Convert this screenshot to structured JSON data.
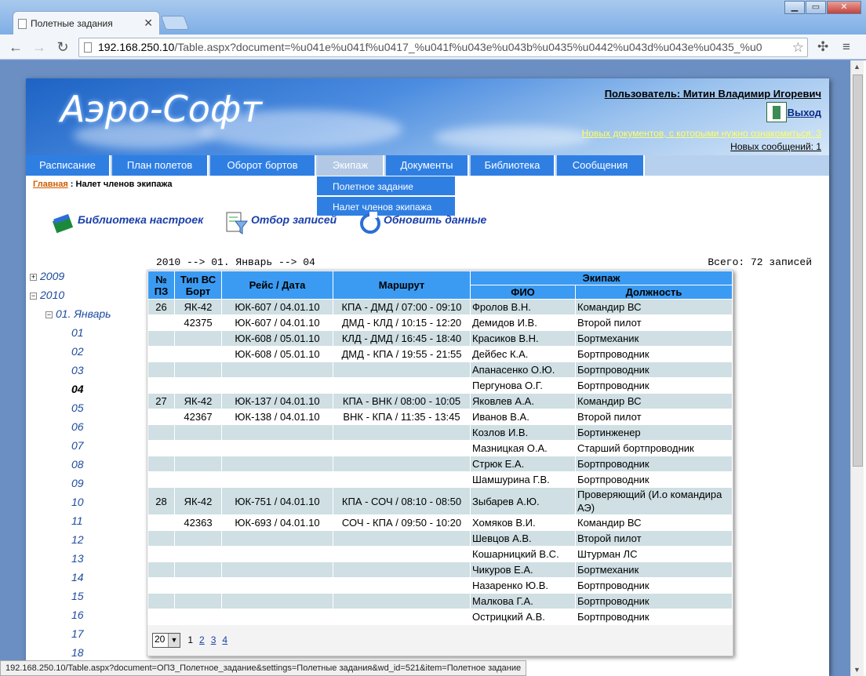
{
  "browser": {
    "tab_title": "Полетные задания",
    "url_host": "192.168.250.10",
    "url_path": "/Table.aspx?document=%u041e%u041f%u0417_%u041f%u043e%u043b%u0435%u0442%u043d%u043e%u0435_%u0",
    "status_url": "192.168.250.10/Table.aspx?document=ОПЗ_Полетное_задание&settings=Полетные задания&wd_id=521&item=Полетное задание"
  },
  "header": {
    "logo": "Аэро-Софт",
    "user": "Пользователь: Митин Владимир Игоревич",
    "exit": "Выход",
    "new_docs": "Новых документов, с которыми нужно ознакомиться: 3",
    "new_msgs": "Новых сообщений: 1"
  },
  "menu": [
    "Расписание",
    "План полетов",
    "Оборот бортов",
    "Экипаж",
    "Документы",
    "Библиотека",
    "Сообщения"
  ],
  "submenu": [
    "Полетное задание",
    "Налет членов экипажа"
  ],
  "breadcrumb": {
    "home": "Главная",
    "current": " : Налет членов экипажа"
  },
  "tools": [
    "Библиотека настроек",
    "Отбор записей",
    "Обновить данные"
  ],
  "filter_text": "2010 --> 01. Январь --> 04",
  "total_text": "Всего: 72 записей",
  "tree": {
    "y2009": "2009",
    "y2010": "2010",
    "month": "01. Январь",
    "days": [
      "01",
      "02",
      "03",
      "04",
      "05",
      "06",
      "07",
      "08",
      "09",
      "10",
      "11",
      "12",
      "13",
      "14",
      "15",
      "16",
      "17",
      "18"
    ],
    "selected": "04"
  },
  "table": {
    "h_num": "№ ПЗ",
    "h_type": "Тип ВС Борт",
    "h_flight": "Рейс / Дата",
    "h_route": "Маршрут",
    "h_crew": "Экипаж",
    "h_fio": "ФИО",
    "h_pos": "Должность",
    "rows": [
      [
        "26",
        "ЯК-42",
        "ЮК-607 / 04.01.10",
        "КПА - ДМД / 07:00 - 09:10",
        "Фролов В.Н.",
        "Командир ВС"
      ],
      [
        "",
        "42375",
        "ЮК-607 / 04.01.10",
        "ДМД - КЛД / 10:15 - 12:20",
        "Демидов И.В.",
        "Второй пилот"
      ],
      [
        "",
        "",
        "ЮК-608 / 05.01.10",
        "КЛД - ДМД / 16:45 - 18:40",
        "Красиков В.Н.",
        "Бортмеханик"
      ],
      [
        "",
        "",
        "ЮК-608 / 05.01.10",
        "ДМД - КПА / 19:55 - 21:55",
        "Дейбес К.А.",
        "Бортпроводник"
      ],
      [
        "",
        "",
        "",
        "",
        "Апанасенко О.Ю.",
        "Бортпроводник"
      ],
      [
        "",
        "",
        "",
        "",
        "Пергунова О.Г.",
        "Бортпроводник"
      ],
      [
        "27",
        "ЯК-42",
        "ЮК-137 / 04.01.10",
        "КПА - ВНК / 08:00 - 10:05",
        "Яковлев А.А.",
        "Командир ВС"
      ],
      [
        "",
        "42367",
        "ЮК-138 / 04.01.10",
        "ВНК - КПА / 11:35 - 13:45",
        "Иванов В.А.",
        "Второй пилот"
      ],
      [
        "",
        "",
        "",
        "",
        "Козлов И.В.",
        "Бортинженер"
      ],
      [
        "",
        "",
        "",
        "",
        "Мазницкая О.А.",
        "Старший бортпроводник"
      ],
      [
        "",
        "",
        "",
        "",
        "Стрюк Е.А.",
        "Бортпроводник"
      ],
      [
        "",
        "",
        "",
        "",
        "Шамшурина Г.В.",
        "Бортпроводник"
      ],
      [
        "28",
        "ЯК-42",
        "ЮК-751 / 04.01.10",
        "КПА - СОЧ / 08:10 - 08:50",
        "Зыбарев А.Ю.",
        "Проверяющий (И.о командира АЭ)"
      ],
      [
        "",
        "42363",
        "ЮК-693 / 04.01.10",
        "СОЧ - КПА / 09:50 - 10:20",
        "Хомяков В.И.",
        "Командир ВС"
      ],
      [
        "",
        "",
        "",
        "",
        "Шевцов А.В.",
        "Второй пилот"
      ],
      [
        "",
        "",
        "",
        "",
        "Кошарницкий В.С.",
        "Штурман ЛС"
      ],
      [
        "",
        "",
        "",
        "",
        "Чикуров Е.А.",
        "Бортмеханик"
      ],
      [
        "",
        "",
        "",
        "",
        "Назаренко Ю.В.",
        "Бортпроводник"
      ],
      [
        "",
        "",
        "",
        "",
        "Малкова Г.А.",
        "Бортпроводник"
      ],
      [
        "",
        "",
        "",
        "",
        "Острицкий А.В.",
        "Бортпроводник"
      ]
    ]
  },
  "pager": {
    "size": "20",
    "current": "1",
    "pages": [
      "2",
      "3",
      "4"
    ]
  }
}
